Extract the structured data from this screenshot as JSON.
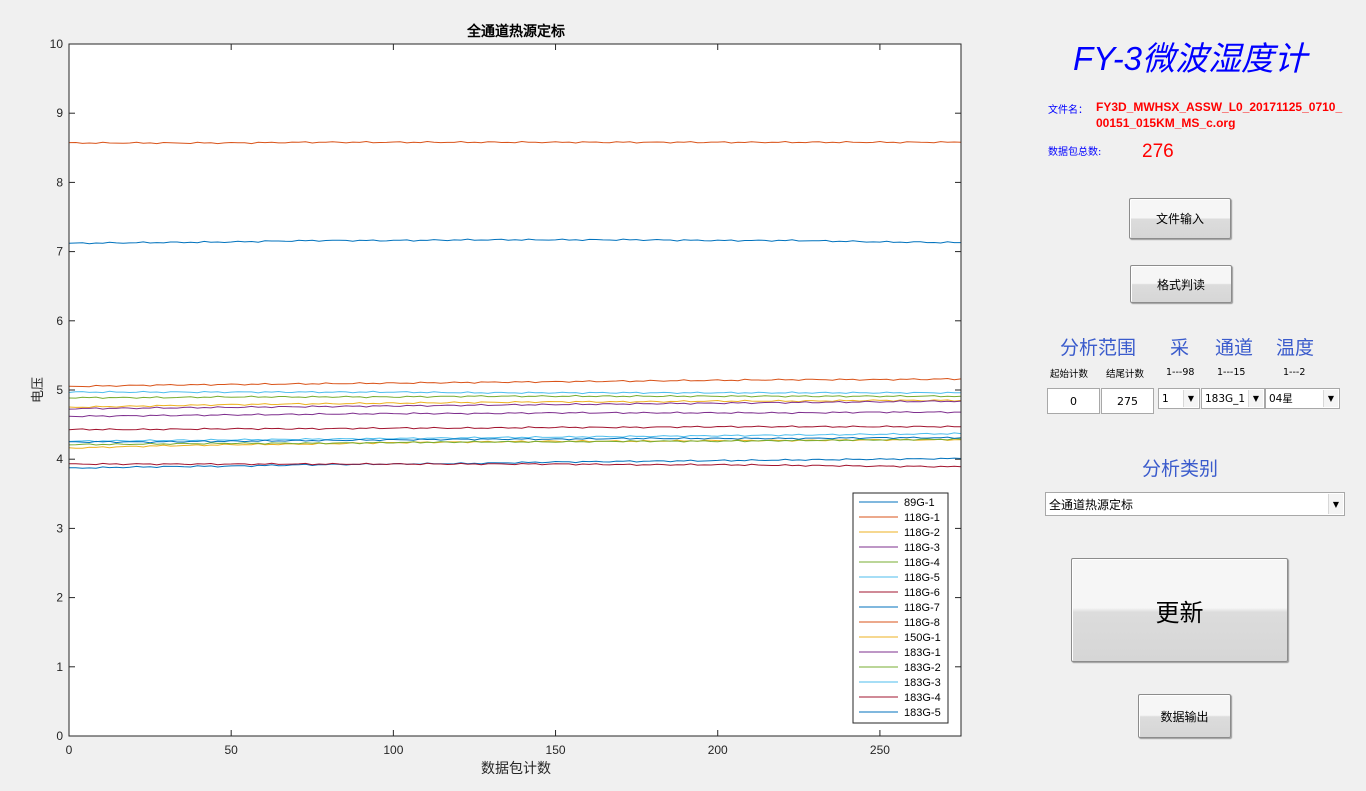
{
  "plot": {
    "title": "全通道热源定标",
    "xlabel": "数据包计数",
    "ylabel": "电压"
  },
  "chart_data": {
    "type": "line",
    "title": "全通道热源定标",
    "xlabel": "数据包计数",
    "ylabel": "电压",
    "xlim": [
      0,
      275
    ],
    "ylim": [
      0,
      10
    ],
    "x_ticks": [
      0,
      50,
      100,
      150,
      200,
      250
    ],
    "y_ticks": [
      0,
      1,
      2,
      3,
      4,
      5,
      6,
      7,
      8,
      9,
      10
    ],
    "legend_position": "bottom-right",
    "grid": false,
    "x": [
      0,
      25,
      50,
      75,
      100,
      125,
      150,
      175,
      200,
      225,
      250,
      275
    ],
    "series": [
      {
        "name": "89G-1",
        "color": "#0072bd",
        "values": [
          7.12,
          7.13,
          7.14,
          7.16,
          7.16,
          7.17,
          7.17,
          7.17,
          7.16,
          7.16,
          7.14,
          7.13
        ]
      },
      {
        "name": "118G-1",
        "color": "#d95319",
        "values": [
          8.57,
          8.57,
          8.57,
          8.58,
          8.58,
          8.58,
          8.58,
          8.58,
          8.58,
          8.58,
          8.58,
          8.58
        ]
      },
      {
        "name": "118G-2",
        "color": "#edb120",
        "values": [
          4.75,
          4.77,
          4.79,
          4.8,
          4.81,
          4.82,
          4.83,
          4.83,
          4.84,
          4.84,
          4.85,
          4.85
        ]
      },
      {
        "name": "118G-3",
        "color": "#7e2f8e",
        "values": [
          4.62,
          4.63,
          4.64,
          4.65,
          4.66,
          4.66,
          4.67,
          4.67,
          4.67,
          4.67,
          4.68,
          4.68
        ]
      },
      {
        "name": "118G-4",
        "color": "#77ac30",
        "values": [
          4.89,
          4.89,
          4.9,
          4.9,
          4.9,
          4.91,
          4.91,
          4.91,
          4.91,
          4.91,
          4.91,
          4.91
        ]
      },
      {
        "name": "118G-5",
        "color": "#4dbeee",
        "values": [
          4.26,
          4.27,
          4.28,
          4.29,
          4.3,
          4.31,
          4.32,
          4.33,
          4.34,
          4.35,
          4.36,
          4.37
        ]
      },
      {
        "name": "118G-6",
        "color": "#a2142f",
        "values": [
          4.43,
          4.43,
          4.44,
          4.44,
          4.45,
          4.45,
          4.46,
          4.46,
          4.47,
          4.47,
          4.47,
          4.47
        ]
      },
      {
        "name": "118G-7",
        "color": "#0072bd",
        "values": [
          3.87,
          3.89,
          3.9,
          3.92,
          3.93,
          3.94,
          3.96,
          3.97,
          3.98,
          3.99,
          4.0,
          4.01
        ]
      },
      {
        "name": "118G-8",
        "color": "#d95319",
        "values": [
          5.05,
          5.07,
          5.08,
          5.09,
          5.1,
          5.11,
          5.12,
          5.13,
          5.14,
          5.15,
          5.15,
          5.16
        ]
      },
      {
        "name": "150G-1",
        "color": "#edb120",
        "values": [
          4.16,
          4.19,
          4.21,
          4.22,
          4.24,
          4.25,
          4.26,
          4.26,
          4.27,
          4.27,
          4.28,
          4.28
        ]
      },
      {
        "name": "183G-1",
        "color": "#7e2f8e",
        "values": [
          4.73,
          4.74,
          4.75,
          4.76,
          4.77,
          4.78,
          4.79,
          4.8,
          4.81,
          4.82,
          4.83,
          4.84
        ]
      },
      {
        "name": "183G-2",
        "color": "#77ac30",
        "values": [
          4.21,
          4.22,
          4.23,
          4.23,
          4.24,
          4.25,
          4.25,
          4.26,
          4.26,
          4.27,
          4.28,
          4.29
        ]
      },
      {
        "name": "183G-3",
        "color": "#4dbeee",
        "values": [
          4.97,
          4.97,
          4.97,
          4.97,
          4.97,
          4.96,
          4.96,
          4.96,
          4.96,
          4.96,
          4.96,
          4.96
        ]
      },
      {
        "name": "183G-4",
        "color": "#a2142f",
        "values": [
          3.93,
          3.93,
          3.93,
          3.93,
          3.93,
          3.93,
          3.93,
          3.92,
          3.92,
          3.91,
          3.9,
          3.89
        ]
      },
      {
        "name": "183G-5",
        "color": "#0072bd",
        "values": [
          4.25,
          4.25,
          4.26,
          4.27,
          4.28,
          4.29,
          4.29,
          4.3,
          4.3,
          4.3,
          4.31,
          4.31
        ]
      }
    ]
  },
  "panel": {
    "app_title": "FY-3微波湿度计",
    "file_name_label": "文件名：",
    "file_name_value": "FY3D_MWHSX_ASSW_L0_20171125_0710_00151_015KM_MS_c.org",
    "packet_total_label": "数据包总数:",
    "packet_total_value": "276",
    "btn_file_input": "文件输入",
    "btn_format_check": "格式判读",
    "range_header": "分析范围",
    "sample_header": "采",
    "channel_header": "通道",
    "temp_header": "温度",
    "start_count_label": "起始计数",
    "end_count_label": "结尾计数",
    "sample_range": "1---98",
    "channel_range": "1---15",
    "temp_range": "1---2",
    "start_count_value": "0",
    "end_count_value": "275",
    "sample_select": "1",
    "channel_select": "183G_1",
    "temp_select": "04星",
    "analysis_type_header": "分析类别",
    "analysis_type_select": "全通道热源定标",
    "btn_update": "更新",
    "btn_data_output": "数据输出"
  }
}
